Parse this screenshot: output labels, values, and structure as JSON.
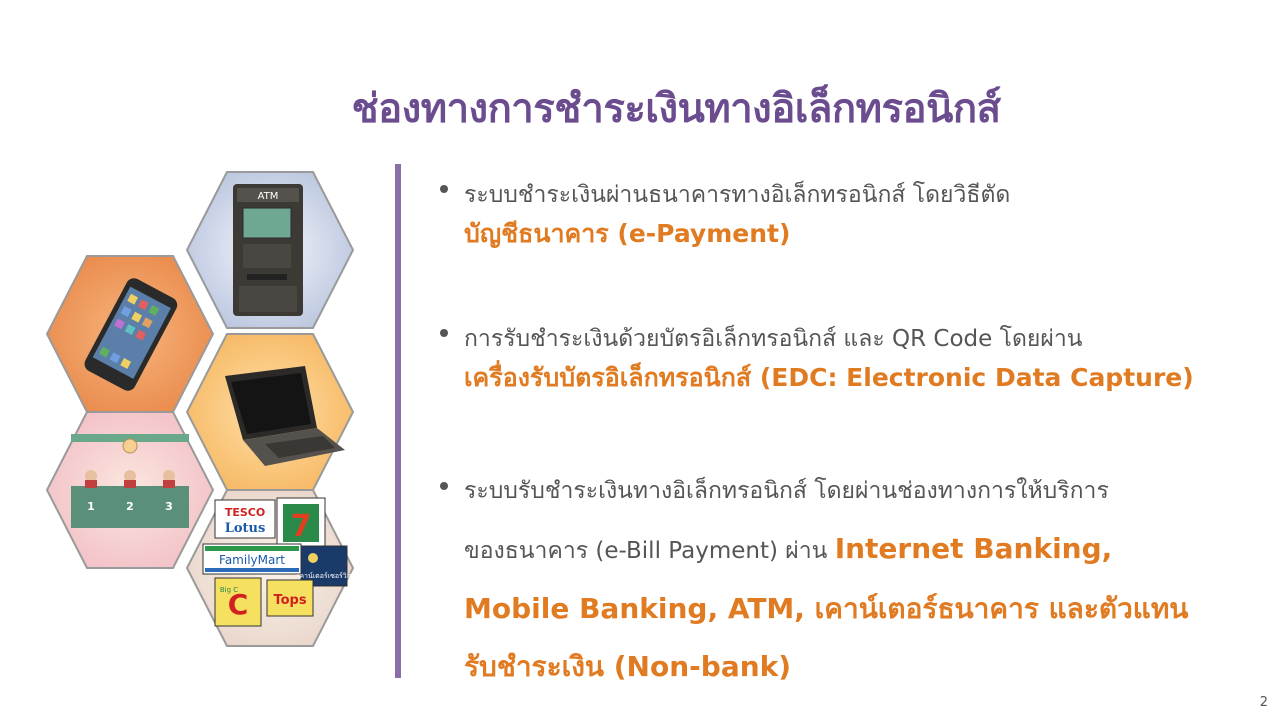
{
  "slide": {
    "title": "ช่องทางการชำระเงินทางอิเล็กทรอนิกส์",
    "page_number": "2"
  },
  "bullets": [
    {
      "line1": "ระบบชำระเงินผ่านธนาคารทางอิเล็กทรอนิกส์ โดยวิธีตัด",
      "highlight": "บัญชีธนาคาร (e-Payment)"
    },
    {
      "line1": "การรับชำระเงินด้วยบัตรอิเล็กทรอนิกส์ และ QR Code โดยผ่าน",
      "highlight": "เครื่องรับบัตรอิเล็กทรอนิกส์ (EDC: Electronic Data Capture)"
    },
    {
      "line1": "ระบบรับชำระเงินทางอิเล็กทรอนิกส์ โดยผ่านช่องทางการให้บริการ",
      "line2_plain": "ของธนาคาร (e-Bill Payment) ผ่าน ",
      "line2_highlight": "Internet Banking,",
      "line3": "Mobile Banking, ATM, เคาน์เตอร์ธนาคาร และตัวแทน",
      "line4": "รับชำระเงิน (Non-bank)"
    }
  ],
  "illustration": {
    "atm_label": "ATM",
    "counter_numbers": [
      "1",
      "2",
      "3"
    ],
    "store_logos": [
      "TESCO",
      "Lotus",
      "7",
      "FamilyMart",
      "เคาน์เตอร์เซอร์วิส",
      "Big C",
      "Tops"
    ]
  },
  "colors": {
    "title": "#6b4c8f",
    "accent": "#e07b22",
    "divider": "#8a6ea8",
    "body_text": "#555555"
  }
}
